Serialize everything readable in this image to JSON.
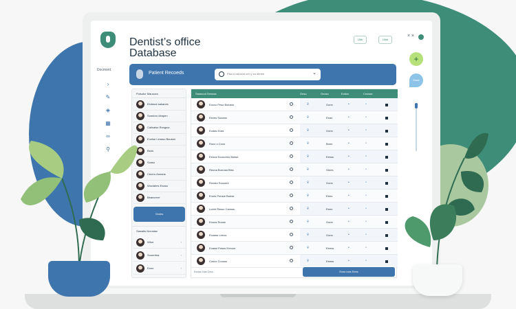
{
  "app": {
    "title_line1": "Dentist’s office",
    "title_line2": "Database"
  },
  "rail": {
    "label": "Docmont"
  },
  "window": {
    "ctrl1": "Ubb",
    "ctrl2": "Ulsb",
    "close": "× ×"
  },
  "header": {
    "title": "Patient Recoeds",
    "search_placeholder": "Plsa d cstrocin c/m y so dimen"
  },
  "left_list": {
    "heading": "Pulsotur Mausocs",
    "patients": [
      "Elutrace sakanes",
      "Sondoro deapen",
      "Calinalse Rongsor",
      "Eonlse Lenaso Bausen",
      "Bsdo",
      "Scaso",
      "Ceurro Annans",
      "Woclahes Exasa",
      "Beancrere"
    ],
    "button_label": "Grwhs"
  },
  "left_card": {
    "heading": "Sawatis Ncrostaz",
    "rows": [
      "Wtoe",
      "Sooerdna",
      "Eono"
    ]
  },
  "table": {
    "headers": [
      "Saseuod Senosa",
      "Gnso",
      "Gnoso",
      "Eoiwo",
      "Cnosse"
    ],
    "rows": [
      {
        "name": "Eocco Peso Botosto",
        "col": "Gonn"
      },
      {
        "name": "Eeces Sooans",
        "col": "Eeao"
      },
      {
        "name": "Eodas Ecas",
        "col": "Gonn"
      },
      {
        "name": "Roco o Coos",
        "col": "Bonn"
      },
      {
        "name": "Eeoca Ecosonno Bosse",
        "col": "Eesss"
      },
      {
        "name": "Reona Borrosa Biss",
        "col": "Giees"
      },
      {
        "name": "Rnosto Soocere",
        "col": "Gonn"
      },
      {
        "name": "Enoio Ponsre Boese",
        "col": "Eeeo"
      },
      {
        "name": "Lcddr Rksuo Cansss",
        "col": "Eeeo"
      },
      {
        "name": "Enoos Roose",
        "col": "Gonn"
      },
      {
        "name": "Eooass Leeos",
        "col": "Gonn"
      },
      {
        "name": "Eoassi Posos Ereoon",
        "col": "Eeess"
      },
      {
        "name": "Cosco Coooss",
        "col": "Eeess"
      }
    ],
    "footer": "Esssia Suss Dvss",
    "button_label": "Eoss ioas Eess"
  },
  "widgets": {
    "blue_label": "Eaae"
  },
  "colors": {
    "primary_blue": "#3e75ac",
    "primary_green": "#3d8d78",
    "accent_lime": "#b6e07a"
  }
}
